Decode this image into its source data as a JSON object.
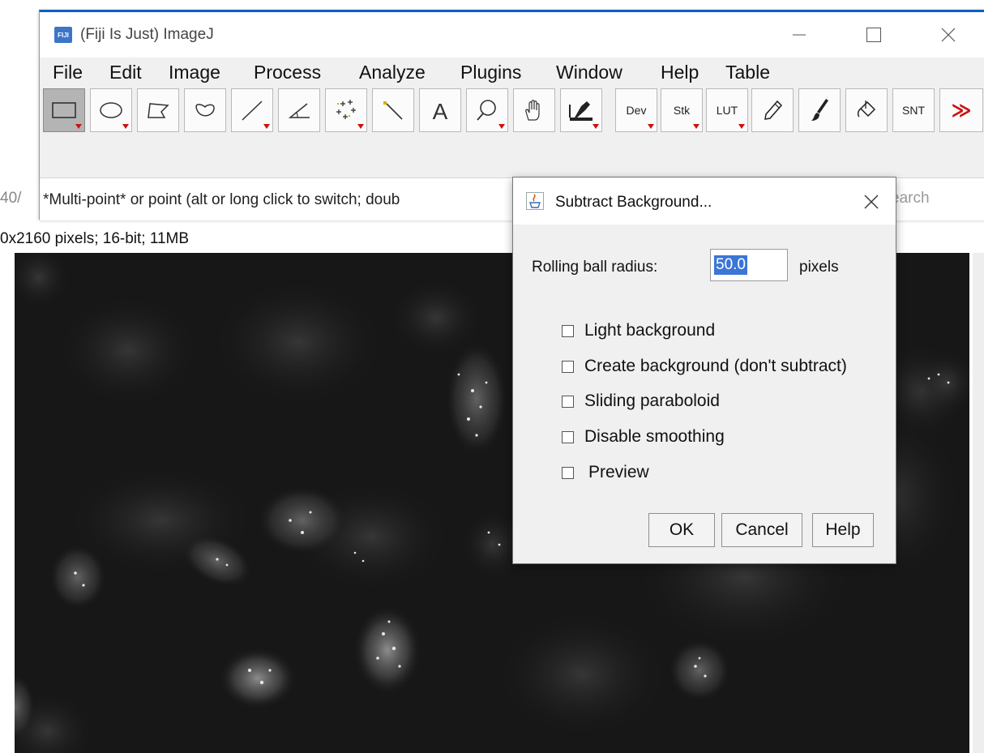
{
  "image_window": {
    "title_fragment": "40/",
    "info": "0x2160 pixels; 16-bit; 11MB"
  },
  "fiji": {
    "title": "(Fiji Is Just) ImageJ",
    "logo_text": "FIJI",
    "menus": [
      "File",
      "Edit",
      "Image",
      "Process",
      "Analyze",
      "Plugins",
      "Window",
      "Help",
      "Table"
    ],
    "tools": [
      {
        "name": "rectangle-tool",
        "icon": "rectangle-icon"
      },
      {
        "name": "oval-tool",
        "icon": "oval-icon"
      },
      {
        "name": "polygon-tool",
        "icon": "polygon-icon"
      },
      {
        "name": "freehand-tool",
        "icon": "freehand-icon"
      },
      {
        "name": "line-tool",
        "icon": "line-icon"
      },
      {
        "name": "angle-tool",
        "icon": "angle-icon"
      },
      {
        "name": "multipoint-tool",
        "icon": "multipoint-icon"
      },
      {
        "name": "wand-tool",
        "icon": "wand-icon"
      },
      {
        "name": "text-tool",
        "icon": "text-icon"
      },
      {
        "name": "magnifier-tool",
        "icon": "magnifier-icon"
      },
      {
        "name": "hand-tool",
        "icon": "hand-icon"
      },
      {
        "name": "dropper-tool",
        "icon": "dropper-icon"
      },
      {
        "name": "dev-tool",
        "label": "Dev"
      },
      {
        "name": "stk-tool",
        "label": "Stk"
      },
      {
        "name": "lut-tool",
        "label": "LUT"
      },
      {
        "name": "pencil-tool",
        "icon": "pencil-icon"
      },
      {
        "name": "brush-tool",
        "icon": "brush-icon"
      },
      {
        "name": "flood-fill-tool",
        "icon": "bucket-icon"
      },
      {
        "name": "snt-tool",
        "label": "SNT"
      },
      {
        "name": "more-tools",
        "label": "≫"
      }
    ],
    "status": "*Multi-point* or point (alt or long click to switch; doub",
    "search_fragment": "earch"
  },
  "dialog": {
    "title": "Subtract Background...",
    "radius_label": "Rolling ball radius:",
    "radius_value": "50.0",
    "radius_unit": "pixels",
    "checkboxes": [
      {
        "label": "Light background",
        "checked": false
      },
      {
        "label": "Create background (don't subtract)",
        "checked": false
      },
      {
        "label": "Sliding paraboloid",
        "checked": false
      },
      {
        "label": "Disable smoothing",
        "checked": false
      },
      {
        "label": "Preview",
        "checked": false
      }
    ],
    "buttons": {
      "ok": "OK",
      "cancel": "Cancel",
      "help": "Help"
    }
  }
}
